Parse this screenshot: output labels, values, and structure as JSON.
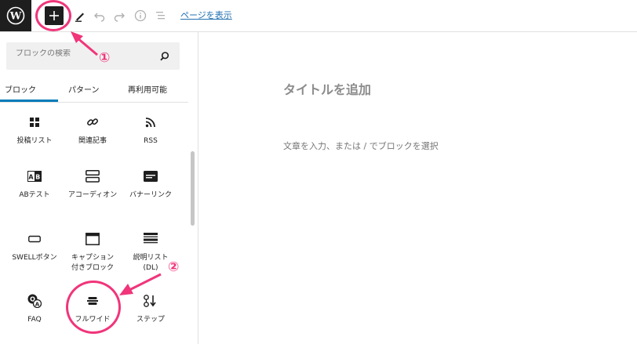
{
  "toolbar": {
    "view_page_link": "ページを表示"
  },
  "inserter": {
    "search_placeholder": "ブロックの検索",
    "tabs": [
      "ブロック",
      "パターン",
      "再利用可能"
    ],
    "active_tab": "ブロック",
    "blocks": [
      {
        "label": "投稿リスト",
        "icon": "grid-icon"
      },
      {
        "label": "関連記事",
        "icon": "link-icon"
      },
      {
        "label": "RSS",
        "icon": "rss-icon"
      },
      {
        "label": "ABテスト",
        "icon": "ab-test-icon"
      },
      {
        "label": "アコーディオン",
        "icon": "accordion-icon"
      },
      {
        "label": "バナーリンク",
        "icon": "banner-icon"
      },
      {
        "label": "SWELLボタン",
        "icon": "button-icon"
      },
      {
        "label": "キャプション付きブロック",
        "icon": "caption-box-icon"
      },
      {
        "label": "説明リスト(DL)",
        "icon": "description-list-icon"
      },
      {
        "label": "FAQ",
        "icon": "faq-icon"
      },
      {
        "label": "フルワイド",
        "icon": "full-wide-icon"
      },
      {
        "label": "ステップ",
        "icon": "step-icon"
      }
    ]
  },
  "editor": {
    "title_placeholder": "タイトルを追加",
    "body_placeholder": "文章を入力、または / でブロックを選択"
  },
  "annotations": {
    "step1": "①",
    "step2": "②",
    "color": "#f0357a"
  },
  "colors": {
    "accent": "#007cba",
    "link": "#2271b1",
    "dark": "#1e1e1e"
  }
}
